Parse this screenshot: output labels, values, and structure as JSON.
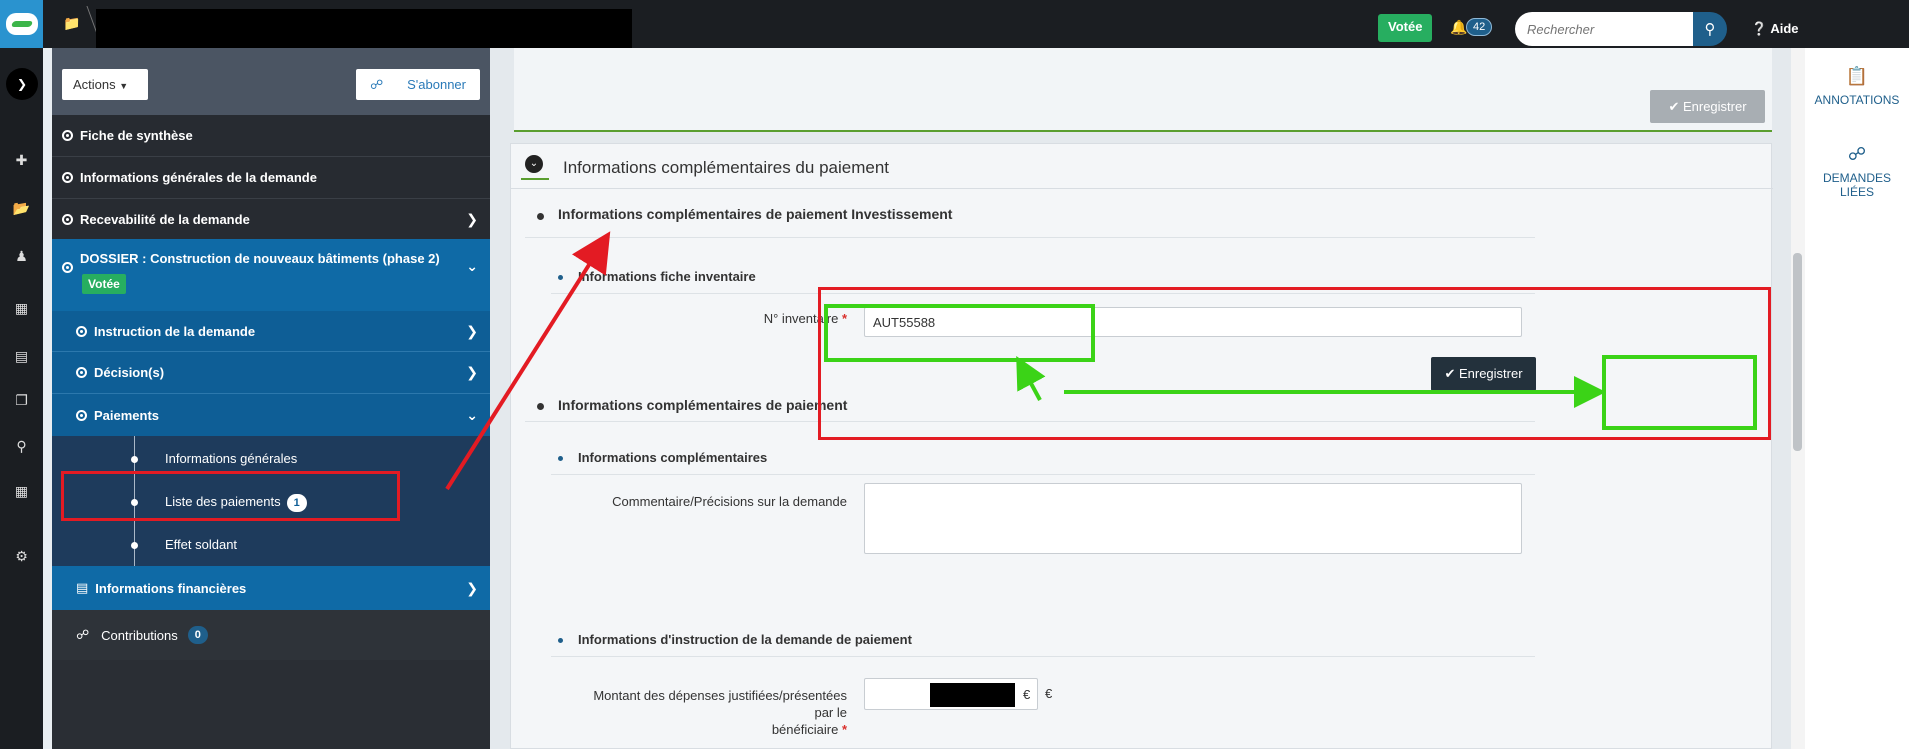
{
  "topbar": {
    "status": "Votée",
    "notif_count": "42",
    "search_placeholder": "Rechercher",
    "help": "Aide"
  },
  "nav": {
    "actions": "Actions",
    "subscribe": "S'abonner",
    "items": [
      {
        "label": "Fiche de synthèse"
      },
      {
        "label": "Informations générales de la demande"
      },
      {
        "label": "Recevabilité de la demande"
      }
    ],
    "dossier": {
      "title": "DOSSIER : Construction de nouveaux bâtiments (phase 2)",
      "badge": "Votée"
    },
    "sub_items": [
      {
        "label": "Instruction de la demande"
      },
      {
        "label": "Décision(s)"
      },
      {
        "label": "Paiements"
      }
    ],
    "paiements_children": [
      {
        "label": "Informations générales"
      },
      {
        "label": "Liste des paiements",
        "badge": "1"
      },
      {
        "label": "Effet soldant"
      }
    ],
    "financial": "Informations financières",
    "contributions": {
      "label": "Contributions",
      "count": "0"
    }
  },
  "main": {
    "save_top": "Enregistrer",
    "panel_title": "Informations complémentaires du paiement",
    "sec1": "Informations complémentaires de paiement Investissement",
    "sub1": "Informations fiche inventaire",
    "inventory_label": "N° inventaire",
    "inventory_value": "AUT55588",
    "save": "Enregistrer",
    "sec2": "Informations complémentaires de paiement",
    "sub2": "Informations complémentaires",
    "comment_label": "Commentaire/Précisions sur la demande",
    "sub3": "Informations d'instruction de la demande de paiement",
    "amount_label_1": "Montant des dépenses justifiées/présentées par le",
    "amount_label_2": "bénéficiaire",
    "currency": "€"
  },
  "right": {
    "annotations": "ANNOTATIONS",
    "linked": "DEMANDES LIÉES"
  }
}
